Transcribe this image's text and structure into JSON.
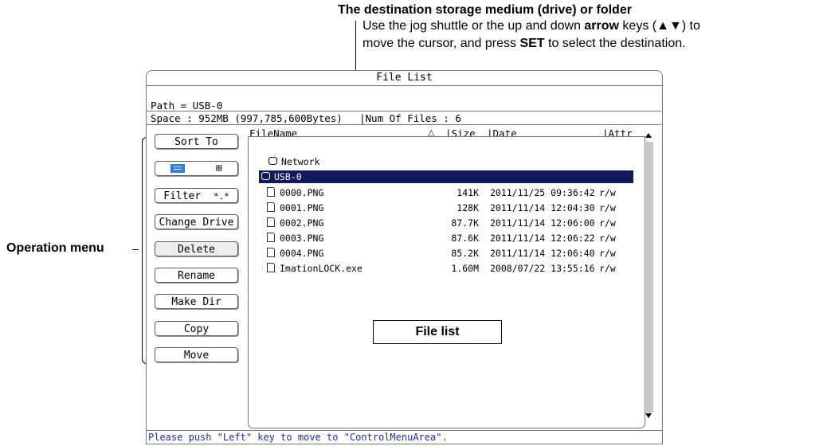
{
  "callouts": {
    "destination_title": "The destination storage medium (drive) or folder",
    "destination_line1_pre": "Use the jog shuttle or the up and down ",
    "destination_line1_bold": "arrow",
    "destination_line1_post": " keys (▲▼) to",
    "destination_line2_pre": "move the cursor, and press ",
    "destination_line2_bold": "SET",
    "destination_line2_post": " to select the destination.",
    "operation_menu": "Operation menu",
    "file_list": "File list"
  },
  "window": {
    "title": "File List",
    "path": "Path = USB-0",
    "space": "Space : 952MB (997,785,600Bytes)",
    "num_files": "|Num Of Files : 6"
  },
  "menu": {
    "sort_to": "Sort To",
    "view_list_icon": "list-view-icon",
    "view_grid_icon": "grid-view-icon",
    "filter": "Filter",
    "filter_value": "*.*",
    "change_drive": "Change Drive",
    "delete": "Delete",
    "rename": "Rename",
    "make_dir": "Make Dir",
    "copy": "Copy",
    "move": "Move"
  },
  "columns": {
    "filename": "FileName",
    "sort_indicator": "△",
    "size": "|Size",
    "date": "|Date",
    "attr": "|Attr"
  },
  "entries": [
    {
      "name": "Network",
      "size": "",
      "date": "",
      "attr": "",
      "icon": "drive-icon"
    },
    {
      "name": "USB-0",
      "size": "",
      "date": "",
      "attr": "",
      "icon": "drive-icon"
    },
    {
      "name": "0000.PNG",
      "size": "141K",
      "date": "2011/11/25 09:36:42",
      "attr": "r/w",
      "icon": "file-icon"
    },
    {
      "name": "0001.PNG",
      "size": "128K",
      "date": "2011/11/14 12:04:30",
      "attr": "r/w",
      "icon": "file-icon"
    },
    {
      "name": "0002.PNG",
      "size": "87.7K",
      "date": "2011/11/14 12:06:00",
      "attr": "r/w",
      "icon": "file-icon"
    },
    {
      "name": "0003.PNG",
      "size": "87.6K",
      "date": "2011/11/14 12:06:22",
      "attr": "r/w",
      "icon": "file-icon"
    },
    {
      "name": "0004.PNG",
      "size": "85.2K",
      "date": "2011/11/14 12:06:40",
      "attr": "r/w",
      "icon": "file-icon"
    },
    {
      "name": "ImationLOCK.exe",
      "size": "1.60M",
      "date": "2008/07/22 13:55:16",
      "attr": "r/w",
      "icon": "file-icon"
    }
  ],
  "status": "Please push \"Left\" key to move to \"ControlMenuArea\".",
  "colors": {
    "selection": "#101a5c",
    "status_text": "#1a2ea8",
    "view_toggle_active": "#2f7fd8"
  }
}
